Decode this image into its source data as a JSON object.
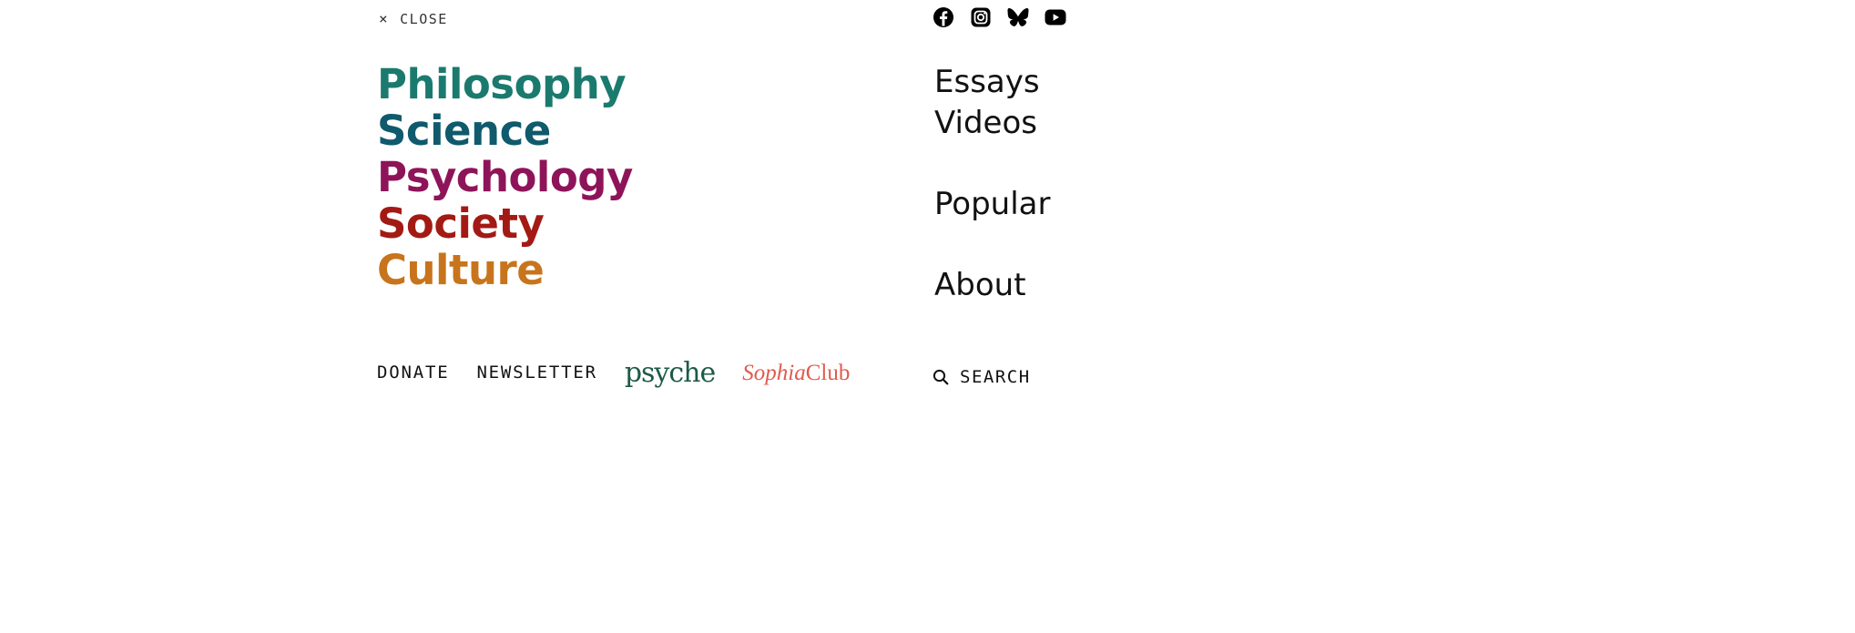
{
  "menu": {
    "close_label": "CLOSE",
    "close_icon": "×"
  },
  "topics": [
    {
      "label": "Philosophy",
      "color": "#1b7a6e"
    },
    {
      "label": "Science",
      "color": "#0f5a6d"
    },
    {
      "label": "Psychology",
      "color": "#8e1459"
    },
    {
      "label": "Society",
      "color": "#a31a14"
    },
    {
      "label": "Culture",
      "color": "#c8741c"
    }
  ],
  "links": {
    "donate": "DONATE",
    "newsletter": "NEWSLETTER",
    "psyche": "psyche",
    "sophia_italic": "Sophia",
    "sophia_rest": "Club"
  },
  "logo_colors": {
    "psyche": "#1d5b45",
    "sophia": "#df5b4e"
  },
  "social": [
    "facebook-icon",
    "instagram-icon",
    "bluesky-icon",
    "youtube-icon"
  ],
  "sections": {
    "essays": "Essays",
    "videos": "Videos",
    "popular": "Popular",
    "about": "About"
  },
  "search": {
    "label": "SEARCH",
    "icon": "search-icon"
  }
}
